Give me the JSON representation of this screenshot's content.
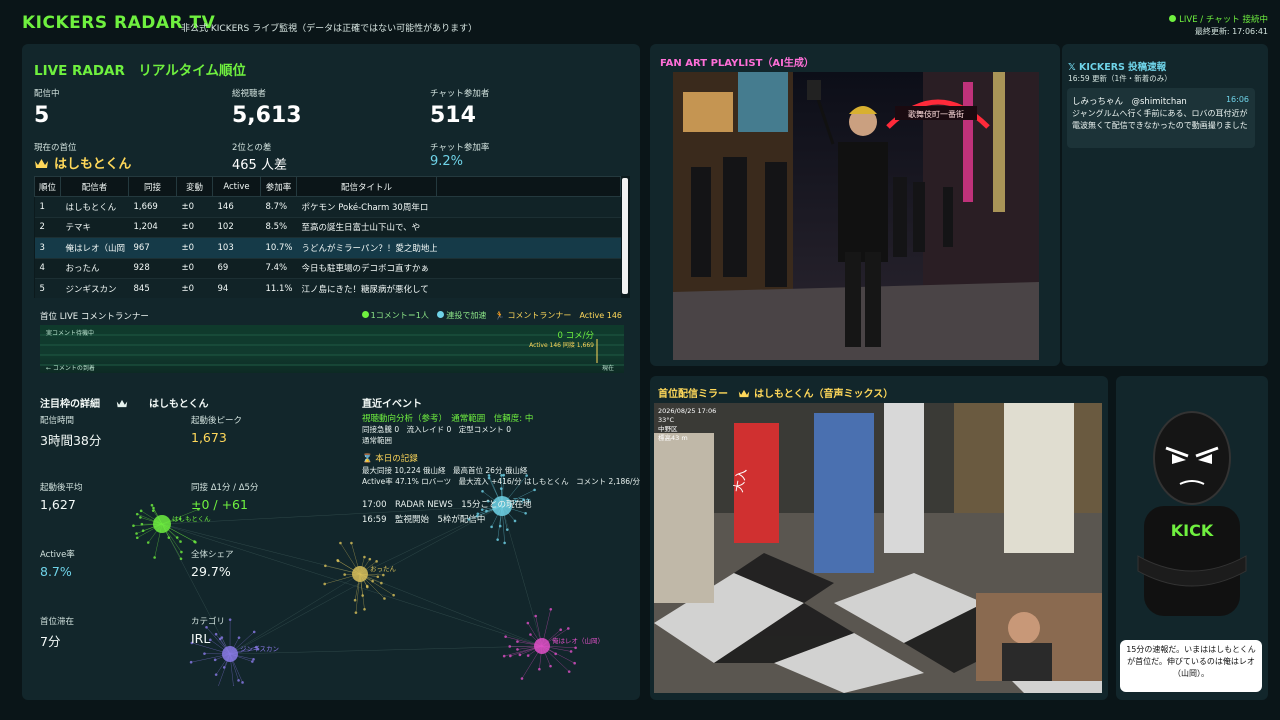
{
  "header": {
    "brand": "KICKERS RADAR TV",
    "subtitle": "非公式 KICKERS ライブ監視（データは正確ではない可能性があります）",
    "live_status": "LIVE / チャット 接続中",
    "last_update": "最終更新: 17:06:41"
  },
  "radar": {
    "title": "LIVE RADAR　リアルタイム順位",
    "live_count_label": "配信中",
    "live_count": "5",
    "viewers_label": "総視聴者",
    "viewers": "5,613",
    "chatters_label": "チャット参加者",
    "chatters": "514",
    "leader_label": "現在の首位",
    "leader": "はしもとくん",
    "gap_label": "2位との差",
    "gap": "465 人差",
    "rate_label": "チャット参加率",
    "rate": "9.2%",
    "table": {
      "headers": [
        "順位",
        "配信者",
        "同接",
        "変動",
        "Active",
        "参加率",
        "配信タイトル"
      ],
      "rows": [
        [
          "1",
          "はしもとくん",
          "1,669",
          "±0",
          "146",
          "8.7%",
          "ポケモン Poké-Charm 30周年ロ"
        ],
        [
          "2",
          "テマキ",
          "1,204",
          "±0",
          "102",
          "8.5%",
          "至高の誕生日富士山下山で、や"
        ],
        [
          "3",
          "俺はレオ（山岡",
          "967",
          "±0",
          "103",
          "10.7%",
          "うどんがミラーパン？！愛之助地上"
        ],
        [
          "4",
          "おったん",
          "928",
          "±0",
          "69",
          "7.4%",
          "今日も駐車場のデコボコ直すかぁ"
        ],
        [
          "5",
          "ジンギスカン",
          "845",
          "±0",
          "94",
          "11.1%",
          "江ノ島にきた！糖尿病が悪化して"
        ]
      ]
    }
  },
  "runner": {
    "title": "首位 LIVE コメントランナー",
    "legend_green": "1コメント＝1人",
    "legend_blue": "連投で加速",
    "legend_label": "コメントランナー",
    "legend_active": "Active 146",
    "rate": "0 コメ/分",
    "small_left_top": "実コメント待機中",
    "small_left_bottom": "← コメントの到着",
    "small_right_top": "Active 146  同接 1,669",
    "small_right_bottom": "現在"
  },
  "detail": {
    "title": "注目枠の詳細",
    "name": "はしもとくん",
    "stats": [
      {
        "label": "配信時間",
        "value": "3時間38分"
      },
      {
        "label": "起動後ピーク",
        "value": "1,673"
      },
      {
        "label": "起動後平均",
        "value": "1,627"
      },
      {
        "label": "同接 Δ1分 / Δ5分",
        "value": "±0 / +61"
      },
      {
        "label": "Active率",
        "value": "8.7%"
      },
      {
        "label": "全体シェア",
        "value": "29.7%"
      },
      {
        "label": "首位滞在",
        "value": "7分"
      },
      {
        "label": "カテゴリ",
        "value": "IRL"
      }
    ]
  },
  "events": {
    "title": "直近イベント",
    "analysis": "視聴動向分析（参考）　通常範囲　信頼度: 中",
    "analysis_sub": "同接急騰 0　流入レイド 0　定型コメント 0",
    "analysis_sub2": "通常範囲",
    "record_title": "本日の記録",
    "record_line1": "最大同接 10,224 俄山経　最高首位 26分 俄山経",
    "record_line2": "Active率 47.1% ロバーツ　最大流入 +416/分 はしもとくん　コメント 2,186/分",
    "log": [
      "17:00　RADAR NEWS　15分ごとの現在地",
      "16:59　監視開始　5枠が配信中"
    ]
  },
  "network": {
    "nodes": [
      {
        "name": "はしもとくん",
        "color": "#6ff03f"
      },
      {
        "name": "テマキ",
        "color": "#6fd3e8"
      },
      {
        "name": "おったん",
        "color": "#d8c05a"
      },
      {
        "name": "俺はレオ（山岡）",
        "color": "#e050c8"
      },
      {
        "name": "ジンギスカン",
        "color": "#8a7ae8"
      }
    ]
  },
  "fanart": {
    "title": "FAN ART PLAYLIST（AI生成）",
    "sign": "歌舞伎町一番街"
  },
  "feed": {
    "title": "KICKERS 投稿速報",
    "subtitle": "16:59 更新（1件・新着のみ）",
    "post": {
      "user": "しみっちゃん　@shimitchan",
      "time": "16:06",
      "text": "ジャングルムへ行く手前にある、ロバの耳付近が電波無くて配信できなかったので動画撮りました"
    }
  },
  "mirror": {
    "title": "首位配信ミラー",
    "name": "はしもとくん（音声ミックス）",
    "osd_line1": "2026/08/25 17:06",
    "osd_line2": "33°C",
    "osd_line3": "中野区",
    "osd_line4": "標高43 m",
    "sign": "大入"
  },
  "mascot": {
    "shirt_text": "KICK",
    "bubble": "15分の速報だ。いまははしもとくんが首位だ。伸びているのは俺はレオ（山岡）。"
  }
}
